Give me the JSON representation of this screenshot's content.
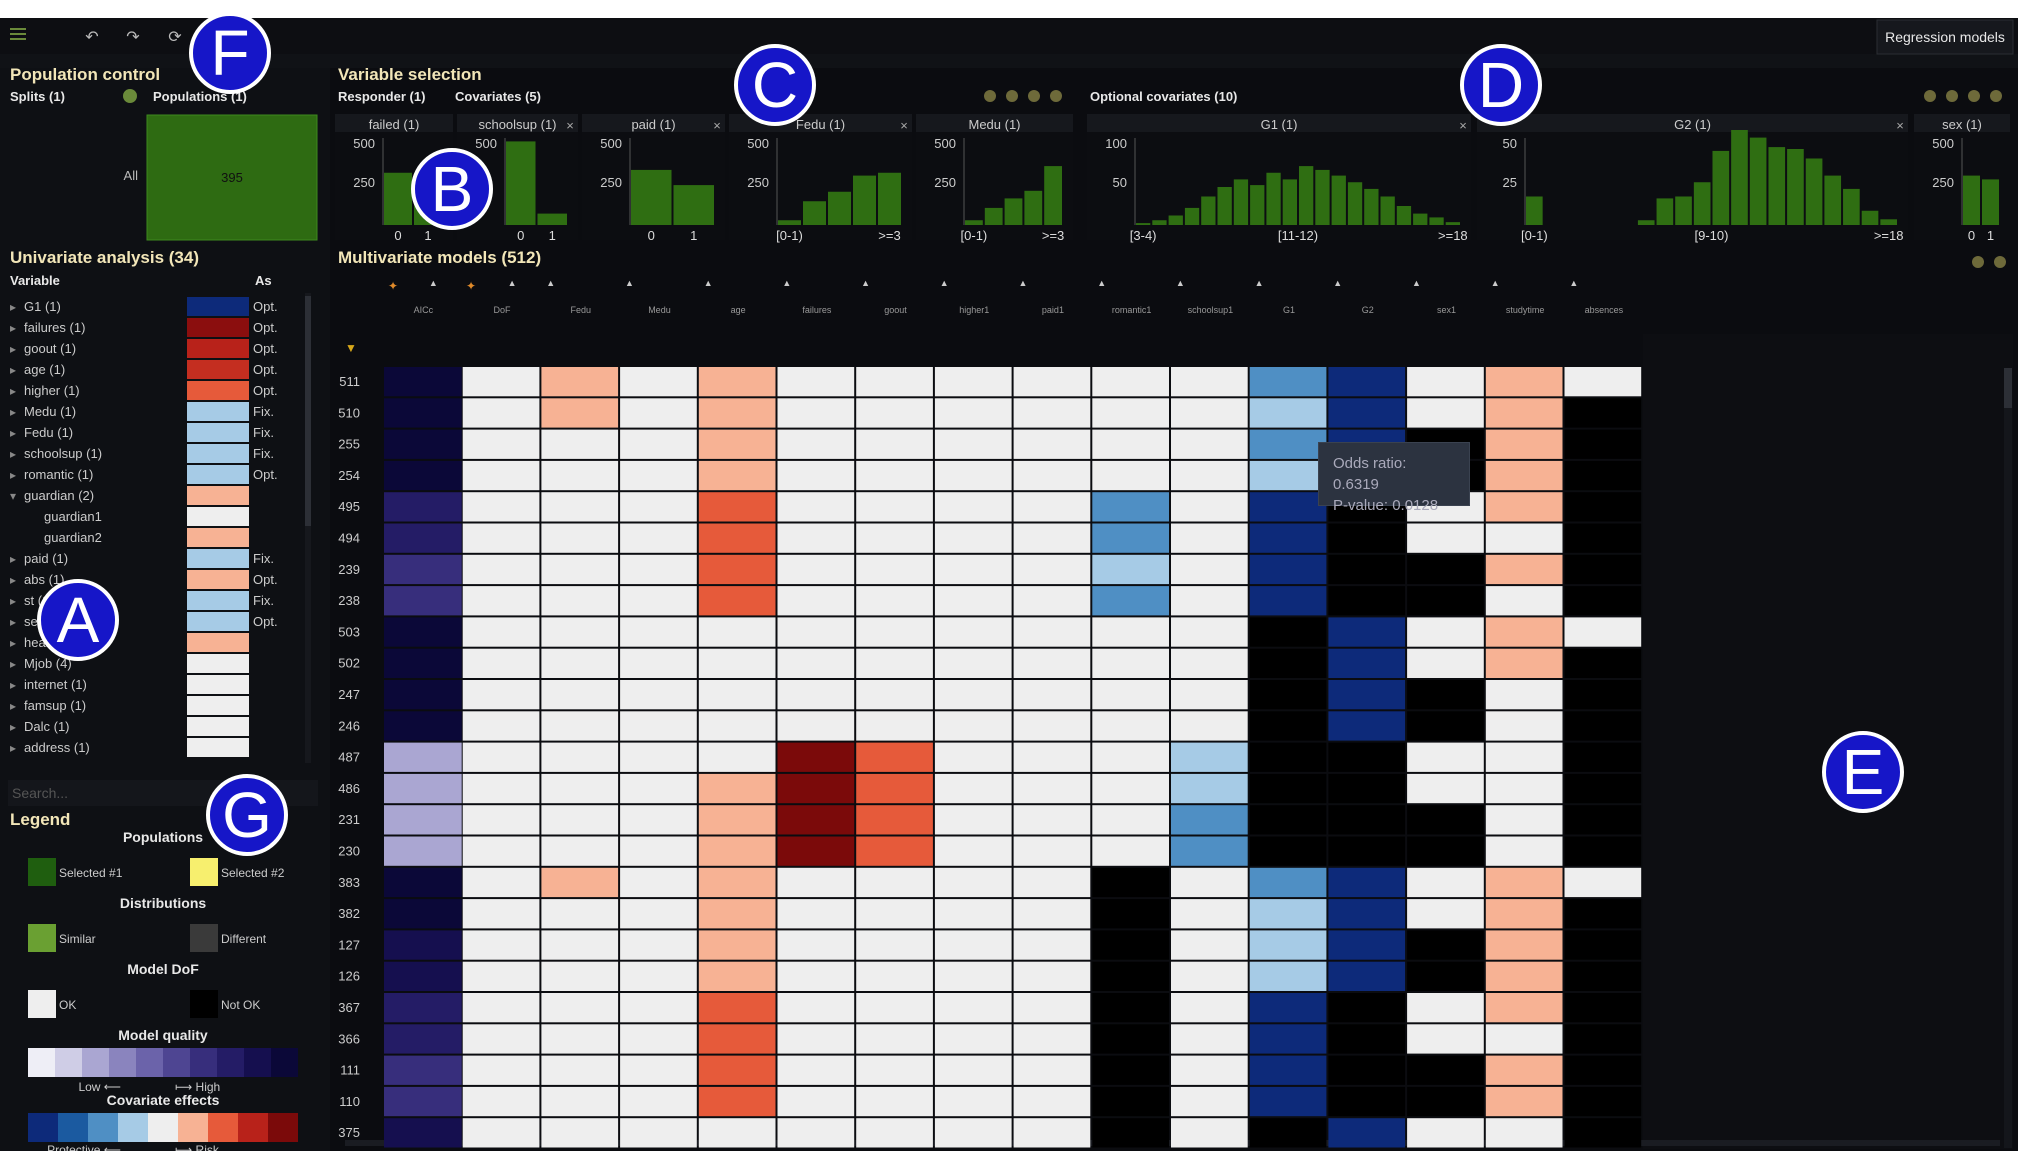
{
  "toolbar": {
    "menu_icon": "hamburger-icon",
    "tool_icons": [
      "undo-icon",
      "redo-icon",
      "refresh-icon"
    ],
    "view_tab": "Regression models"
  },
  "markers": [
    "A",
    "B",
    "C",
    "D",
    "E",
    "F",
    "G"
  ],
  "population": {
    "title": "Population control",
    "splits_label": "Splits (1)",
    "populations_label": "Populations (1)",
    "row_label": "All",
    "count": "395",
    "color": "#2e6b12"
  },
  "variable_selection": {
    "title": "Variable selection",
    "responder_label": "Responder (1)",
    "covariates_label": "Covariates (5)",
    "optional_label": "Optional covariates (10)",
    "histograms": [
      {
        "name": "failed (1)",
        "yticks": [
          "500",
          "250"
        ],
        "xticks": [
          "0",
          "1"
        ],
        "bars": [
          0.55,
          0.38
        ],
        "closable": false
      },
      {
        "name": "schoolsup (1)",
        "yticks": [
          "500"
        ],
        "xticks": [
          "0",
          "1"
        ],
        "bars": [
          0.88,
          0.12
        ],
        "closable": true
      },
      {
        "name": "paid (1)",
        "yticks": [
          "500",
          "250"
        ],
        "xticks": [
          "0",
          "1"
        ],
        "bars": [
          0.58,
          0.42
        ],
        "closable": true
      },
      {
        "name": "Fedu (1)",
        "yticks": [
          "500",
          "250"
        ],
        "xticks": [
          "[0-1)",
          ">=3"
        ],
        "bars": [
          0.05,
          0.25,
          0.35,
          0.52,
          0.55
        ],
        "closable": true
      },
      {
        "name": "Medu (1)",
        "yticks": [
          "500",
          "250"
        ],
        "xticks": [
          "[0-1)",
          ">=3"
        ],
        "bars": [
          0.05,
          0.18,
          0.28,
          0.36,
          0.62
        ],
        "closable": false
      },
      {
        "name": "G1 (1)",
        "yticks": [
          "100",
          "50"
        ],
        "xticks": [
          "[3-4)",
          "[11-12)",
          ">=18"
        ],
        "bars": [
          0.02,
          0.05,
          0.1,
          0.18,
          0.3,
          0.4,
          0.48,
          0.42,
          0.55,
          0.48,
          0.62,
          0.58,
          0.52,
          0.45,
          0.38,
          0.3,
          0.2,
          0.12,
          0.08,
          0.03
        ],
        "closable": true
      },
      {
        "name": "G2 (1)",
        "yticks": [
          "50",
          "25"
        ],
        "xticks": [
          "[0-1)",
          "[9-10)",
          ">=18"
        ],
        "bars": [
          0.3,
          0,
          0,
          0,
          0,
          0,
          0.05,
          0.28,
          0.3,
          0.45,
          0.78,
          1.0,
          0.92,
          0.82,
          0.8,
          0.7,
          0.52,
          0.38,
          0.15,
          0.06
        ],
        "closable": true
      },
      {
        "name": "sex (1)",
        "yticks": [
          "500",
          "250"
        ],
        "xticks": [
          "0",
          "1"
        ],
        "bars": [
          0.52,
          0.48
        ],
        "closable": false
      }
    ]
  },
  "univariate": {
    "title": "Univariate analysis (34)",
    "col_variable": "Variable",
    "col_as": "As",
    "search_placeholder": "Search...",
    "rows": [
      {
        "label": "G1 (1)",
        "color": "#0d2a7a",
        "as": "Opt.",
        "arrow": "▸"
      },
      {
        "label": "failures (1)",
        "color": "#8b0e0e",
        "as": "Opt.",
        "arrow": "▸"
      },
      {
        "label": "goout (1)",
        "color": "#b8221a",
        "as": "Opt.",
        "arrow": "▸"
      },
      {
        "label": "age (1)",
        "color": "#c42e20",
        "as": "Opt.",
        "arrow": "▸"
      },
      {
        "label": "higher (1)",
        "color": "#e65a3a",
        "as": "Opt.",
        "arrow": "▸"
      },
      {
        "label": "Medu (1)",
        "color": "#a6cbe6",
        "as": "Fix.",
        "arrow": "▸"
      },
      {
        "label": "Fedu (1)",
        "color": "#a6cbe6",
        "as": "Fix.",
        "arrow": "▸"
      },
      {
        "label": "schoolsup (1)",
        "color": "#a6cbe6",
        "as": "Fix.",
        "arrow": "▸"
      },
      {
        "label": "romantic (1)",
        "color": "#a6cbe6",
        "as": "Opt.",
        "arrow": "▸"
      },
      {
        "label": "guardian (2)",
        "color": "#f7b294",
        "as": "",
        "arrow": "▾"
      },
      {
        "label": "guardian1",
        "color": "#eeeeee",
        "as": "",
        "arrow": "",
        "indent": true
      },
      {
        "label": "guardian2",
        "color": "#f7b294",
        "as": "",
        "arrow": "",
        "indent": true
      },
      {
        "label": "paid (1)",
        "color": "#a6cbe6",
        "as": "Fix.",
        "arrow": "▸"
      },
      {
        "label": "abs (1)",
        "color": "#f7b294",
        "as": "Opt.",
        "arrow": "▸"
      },
      {
        "label": "st (1)",
        "color": "#a6cbe6",
        "as": "Fix.",
        "arrow": "▸"
      },
      {
        "label": "sex (1)",
        "color": "#a6cbe6",
        "as": "Opt.",
        "arrow": "▸"
      },
      {
        "label": "health (1)",
        "color": "#f7b294",
        "as": "",
        "arrow": "▸"
      },
      {
        "label": "Mjob (4)",
        "color": "#eeeeee",
        "as": "",
        "arrow": "▸"
      },
      {
        "label": "internet (1)",
        "color": "#eeeeee",
        "as": "",
        "arrow": "▸"
      },
      {
        "label": "famsup (1)",
        "color": "#eeeeee",
        "as": "",
        "arrow": "▸"
      },
      {
        "label": "Dalc (1)",
        "color": "#eeeeee",
        "as": "",
        "arrow": "▸"
      },
      {
        "label": "address (1)",
        "color": "#eeeeee",
        "as": "",
        "arrow": "▸"
      }
    ]
  },
  "legend": {
    "title": "Legend",
    "populations_title": "Populations",
    "selected1": {
      "label": "Selected #1",
      "color": "#1f5e0f"
    },
    "selected2": {
      "label": "Selected #2",
      "color": "#f7ef6e"
    },
    "distributions_title": "Distributions",
    "similar": {
      "label": "Similar",
      "color": "#6aa032"
    },
    "different": {
      "label": "Different",
      "color": "#3a3a3a"
    },
    "dof_title": "Model DoF",
    "ok": {
      "label": "OK",
      "color": "#eeeeee"
    },
    "notok": {
      "label": "Not OK",
      "color": "#000000"
    },
    "quality_title": "Model quality",
    "quality_colors": [
      "#eeeef6",
      "#cfcde6",
      "#aaa6d2",
      "#8a84be",
      "#6b63aa",
      "#4e4592",
      "#372e7c",
      "#241c66",
      "#150f4f",
      "#0b0838"
    ],
    "quality_low": "Low ⟵",
    "quality_high": "⟼ High",
    "effects_title": "Covariate effects",
    "effects_colors": [
      "#0d2a7a",
      "#1b5aa0",
      "#4f8fc4",
      "#a6cbe6",
      "#eeeeee",
      "#f7b294",
      "#e65a3a",
      "#b8221a",
      "#7b0a0a"
    ],
    "effects_low": "Protective ⟵",
    "effects_high": "⟼ Risk"
  },
  "multivariate": {
    "title": "Multivariate models (512)",
    "columns": [
      "AICc",
      "DoF",
      "Fedu",
      "Medu",
      "age",
      "failures",
      "goout",
      "higher1",
      "paid1",
      "romantic1",
      "schoolsup1",
      "G1",
      "G2",
      "sex1",
      "studytime",
      "absences"
    ],
    "row_ids": [
      "511",
      "510",
      "255",
      "254",
      "495",
      "494",
      "239",
      "238",
      "503",
      "502",
      "247",
      "246",
      "487",
      "486",
      "231",
      "230",
      "383",
      "382",
      "127",
      "126",
      "367",
      "366",
      "111",
      "110",
      "375"
    ],
    "quality": [
      9,
      9,
      9,
      9,
      7,
      7,
      6,
      6,
      9,
      9,
      9,
      9,
      2,
      2,
      2,
      2,
      9,
      9,
      8,
      8,
      7,
      7,
      6,
      6,
      8
    ],
    "effect_rows": [
      [
        "ok",
        "p1",
        "ok",
        "p1",
        "ok",
        "ok",
        "ok",
        "ok",
        "ok",
        "ok",
        "b3",
        "n1",
        "ok",
        "p1",
        "ok"
      ],
      [
        "ok",
        "p1",
        "ok",
        "p1",
        "ok",
        "ok",
        "ok",
        "ok",
        "ok",
        "ok",
        "b1",
        "n1",
        "ok",
        "p1",
        "na"
      ],
      [
        "ok",
        "ok",
        "ok",
        "p1",
        "ok",
        "ok",
        "ok",
        "ok",
        "ok",
        "ok",
        "b3",
        "n1",
        "na",
        "p1",
        "na"
      ],
      [
        "ok",
        "ok",
        "ok",
        "p1",
        "ok",
        "ok",
        "ok",
        "ok",
        "ok",
        "ok",
        "b1",
        "n1",
        "na",
        "p1",
        "na"
      ],
      [
        "ok",
        "ok",
        "ok",
        "p2",
        "ok",
        "ok",
        "ok",
        "ok",
        "b3",
        "ok",
        "n1",
        "na",
        "ok",
        "p1",
        "na"
      ],
      [
        "ok",
        "ok",
        "ok",
        "p2",
        "ok",
        "ok",
        "ok",
        "ok",
        "b3",
        "ok",
        "n1",
        "na",
        "ok",
        "ok",
        "na"
      ],
      [
        "ok",
        "ok",
        "ok",
        "p2",
        "ok",
        "ok",
        "ok",
        "ok",
        "b1",
        "ok",
        "n1",
        "na",
        "na",
        "p1",
        "na"
      ],
      [
        "ok",
        "ok",
        "ok",
        "p2",
        "ok",
        "ok",
        "ok",
        "ok",
        "b3",
        "ok",
        "n1",
        "na",
        "na",
        "ok",
        "na"
      ],
      [
        "ok",
        "ok",
        "ok",
        "ok",
        "ok",
        "ok",
        "ok",
        "ok",
        "ok",
        "ok",
        "na",
        "n1",
        "ok",
        "p1",
        "ok"
      ],
      [
        "ok",
        "ok",
        "ok",
        "ok",
        "ok",
        "ok",
        "ok",
        "ok",
        "ok",
        "ok",
        "na",
        "n1",
        "ok",
        "p1",
        "na"
      ],
      [
        "ok",
        "ok",
        "ok",
        "ok",
        "ok",
        "ok",
        "ok",
        "ok",
        "ok",
        "ok",
        "na",
        "n1",
        "na",
        "ok",
        "na"
      ],
      [
        "ok",
        "ok",
        "ok",
        "ok",
        "ok",
        "ok",
        "ok",
        "ok",
        "ok",
        "ok",
        "na",
        "n1",
        "na",
        "ok",
        "na"
      ],
      [
        "ok",
        "ok",
        "ok",
        "ok",
        "r3",
        "p2",
        "ok",
        "ok",
        "ok",
        "b1",
        "na",
        "na",
        "ok",
        "ok",
        "na"
      ],
      [
        "ok",
        "ok",
        "ok",
        "p1",
        "r3",
        "p2",
        "ok",
        "ok",
        "ok",
        "b1",
        "na",
        "na",
        "ok",
        "ok",
        "na"
      ],
      [
        "ok",
        "ok",
        "ok",
        "p1",
        "r3",
        "p2",
        "ok",
        "ok",
        "ok",
        "b3",
        "na",
        "na",
        "na",
        "ok",
        "na"
      ],
      [
        "ok",
        "ok",
        "ok",
        "p1",
        "r3",
        "p2",
        "ok",
        "ok",
        "ok",
        "b3",
        "na",
        "na",
        "na",
        "ok",
        "na"
      ],
      [
        "ok",
        "p1",
        "ok",
        "p1",
        "ok",
        "ok",
        "ok",
        "ok",
        "na",
        "ok",
        "b3",
        "n1",
        "ok",
        "p1",
        "ok"
      ],
      [
        "ok",
        "ok",
        "ok",
        "p1",
        "ok",
        "ok",
        "ok",
        "ok",
        "na",
        "ok",
        "b1",
        "n1",
        "ok",
        "p1",
        "na"
      ],
      [
        "ok",
        "ok",
        "ok",
        "p1",
        "ok",
        "ok",
        "ok",
        "ok",
        "na",
        "ok",
        "b1",
        "n1",
        "na",
        "p1",
        "na"
      ],
      [
        "ok",
        "ok",
        "ok",
        "p1",
        "ok",
        "ok",
        "ok",
        "ok",
        "na",
        "ok",
        "b1",
        "n1",
        "na",
        "p1",
        "na"
      ],
      [
        "ok",
        "ok",
        "ok",
        "p2",
        "ok",
        "ok",
        "ok",
        "ok",
        "na",
        "ok",
        "n1",
        "na",
        "ok",
        "p1",
        "na"
      ],
      [
        "ok",
        "ok",
        "ok",
        "p2",
        "ok",
        "ok",
        "ok",
        "ok",
        "na",
        "ok",
        "n1",
        "na",
        "ok",
        "ok",
        "na"
      ],
      [
        "ok",
        "ok",
        "ok",
        "p2",
        "ok",
        "ok",
        "ok",
        "ok",
        "na",
        "ok",
        "n1",
        "na",
        "na",
        "p1",
        "na"
      ],
      [
        "ok",
        "ok",
        "ok",
        "p2",
        "ok",
        "ok",
        "ok",
        "ok",
        "na",
        "ok",
        "n1",
        "na",
        "na",
        "p1",
        "na"
      ],
      [
        "ok",
        "ok",
        "ok",
        "ok",
        "ok",
        "ok",
        "ok",
        "ok",
        "na",
        "ok",
        "na",
        "n1",
        "ok",
        "ok",
        "na"
      ]
    ],
    "effect_colors": {
      "ok": "#eeeeee",
      "na": "#000000",
      "p1": "#f7b294",
      "p2": "#e65a3a",
      "r3": "#7b0a0a",
      "b1": "#a6cbe6",
      "b3": "#4f8fc4",
      "n1": "#0d2a7a"
    },
    "tooltip": {
      "odds": "Odds ratio: 0.6319",
      "pvalue": "P-value: 0.0128"
    }
  }
}
